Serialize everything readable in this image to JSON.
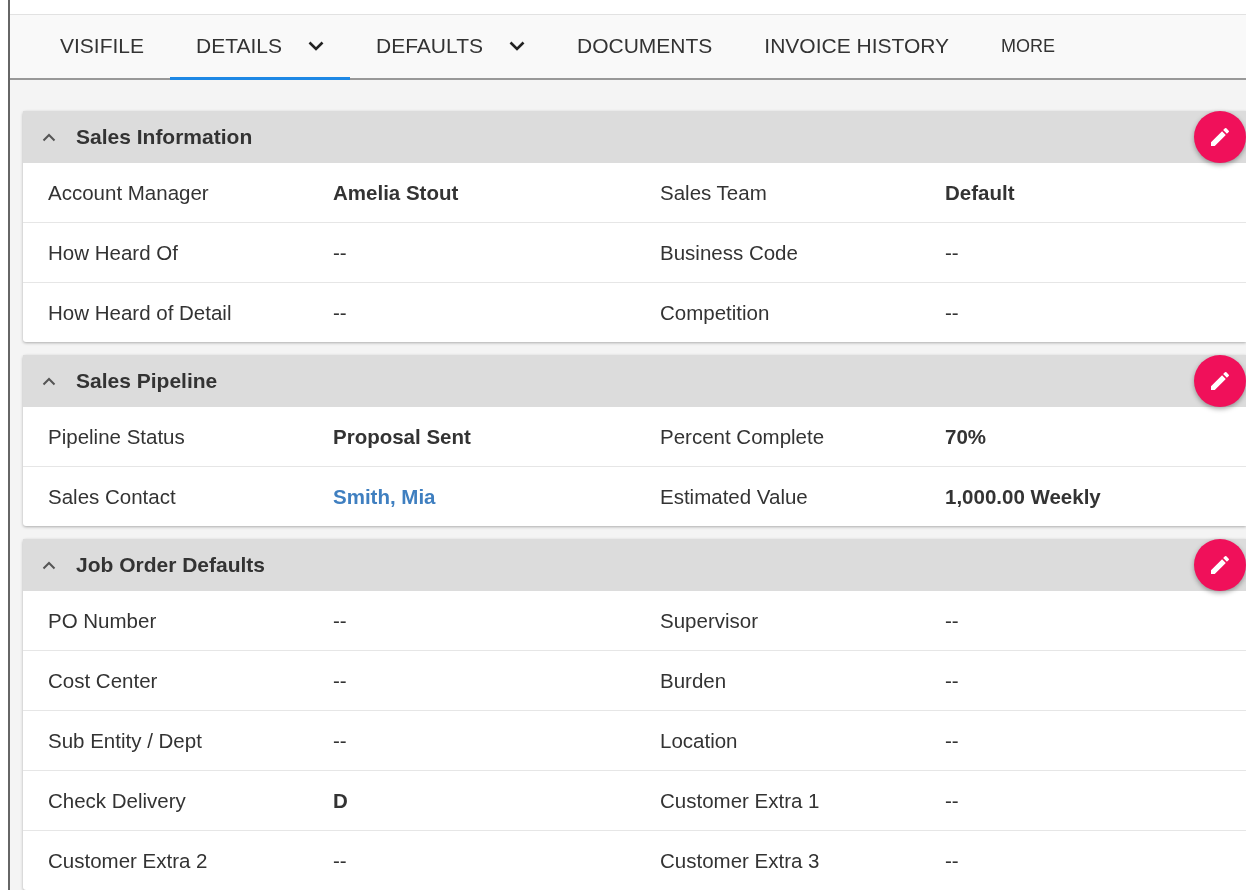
{
  "tabs": [
    {
      "label": "VISIFILE",
      "selected": false,
      "has_menu": false,
      "kind": "tab"
    },
    {
      "label": "DETAILS",
      "selected": true,
      "has_menu": true,
      "kind": "tab"
    },
    {
      "label": "DEFAULTS",
      "selected": false,
      "has_menu": true,
      "kind": "tab"
    },
    {
      "label": "DOCUMENTS",
      "selected": false,
      "has_menu": false,
      "kind": "tab"
    },
    {
      "label": "INVOICE HISTORY",
      "selected": false,
      "has_menu": false,
      "kind": "tab"
    },
    {
      "label": "MORE",
      "selected": false,
      "has_menu": false,
      "kind": "more"
    }
  ],
  "sections": [
    {
      "title": "Sales Information",
      "expanded": true,
      "rows": [
        [
          {
            "label": "Account Manager",
            "value": "Amelia Stout",
            "kind": "value"
          },
          {
            "label": "Sales Team",
            "value": "Default",
            "kind": "value"
          }
        ],
        [
          {
            "label": "How Heard Of",
            "value": "--",
            "kind": "empty"
          },
          {
            "label": "Business Code",
            "value": "--",
            "kind": "empty"
          }
        ],
        [
          {
            "label": "How Heard of Detail",
            "value": "--",
            "kind": "empty"
          },
          {
            "label": "Competition",
            "value": "--",
            "kind": "empty"
          }
        ]
      ]
    },
    {
      "title": "Sales Pipeline",
      "expanded": true,
      "rows": [
        [
          {
            "label": "Pipeline Status",
            "value": "Proposal Sent",
            "kind": "value"
          },
          {
            "label": "Percent Complete",
            "value": "70%",
            "kind": "value"
          }
        ],
        [
          {
            "label": "Sales Contact",
            "value": "Smith, Mia",
            "kind": "link"
          },
          {
            "label": "Estimated Value",
            "value": "1,000.00 Weekly",
            "kind": "value"
          }
        ]
      ]
    },
    {
      "title": "Job Order Defaults",
      "expanded": true,
      "rows": [
        [
          {
            "label": "PO Number",
            "value": "--",
            "kind": "empty"
          },
          {
            "label": "Supervisor",
            "value": "--",
            "kind": "empty"
          }
        ],
        [
          {
            "label": "Cost Center",
            "value": "--",
            "kind": "empty"
          },
          {
            "label": "Burden",
            "value": "--",
            "kind": "empty"
          }
        ],
        [
          {
            "label": "Sub Entity / Dept",
            "value": "--",
            "kind": "empty"
          },
          {
            "label": "Location",
            "value": "--",
            "kind": "empty"
          }
        ],
        [
          {
            "label": "Check Delivery",
            "value": "D",
            "kind": "value"
          },
          {
            "label": "Customer Extra 1",
            "value": "--",
            "kind": "empty"
          }
        ],
        [
          {
            "label": "Customer Extra 2",
            "value": "--",
            "kind": "empty"
          },
          {
            "label": "Customer Extra 3",
            "value": "--",
            "kind": "empty"
          }
        ]
      ]
    }
  ]
}
